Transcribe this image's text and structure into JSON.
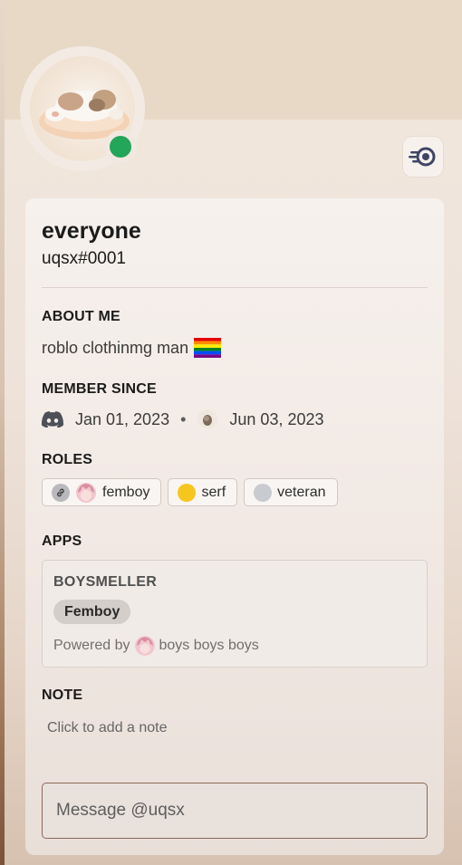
{
  "profile": {
    "display_name": "everyone",
    "username": "uqsx#0001",
    "status": "online"
  },
  "about": {
    "title": "ABOUT ME",
    "text": "roblo clothinmg man",
    "emoji": "pride-flag"
  },
  "member_since": {
    "title": "MEMBER SINCE",
    "discord_date": "Jan 01, 2023",
    "separator": "•",
    "server_date": "Jun 03, 2023"
  },
  "roles": {
    "title": "ROLES",
    "items": [
      {
        "label": "femboy",
        "color": "#b9b9bd",
        "icon": "link-icon"
      },
      {
        "label": "serf",
        "color": "#f7c61e"
      },
      {
        "label": "veteran",
        "color": "#c8ccd0"
      }
    ]
  },
  "apps": {
    "title": "APPS",
    "app_name": "BOYSMELLER",
    "badge": "Femboy",
    "powered_by": "Powered by",
    "powered_name": "boys boys boys"
  },
  "note": {
    "title": "NOTE",
    "placeholder": "Click to add a note"
  },
  "message": {
    "placeholder": "Message @uqsx"
  },
  "colors": {
    "status_online": "#23a55a",
    "banner": "#e8d9c7"
  }
}
